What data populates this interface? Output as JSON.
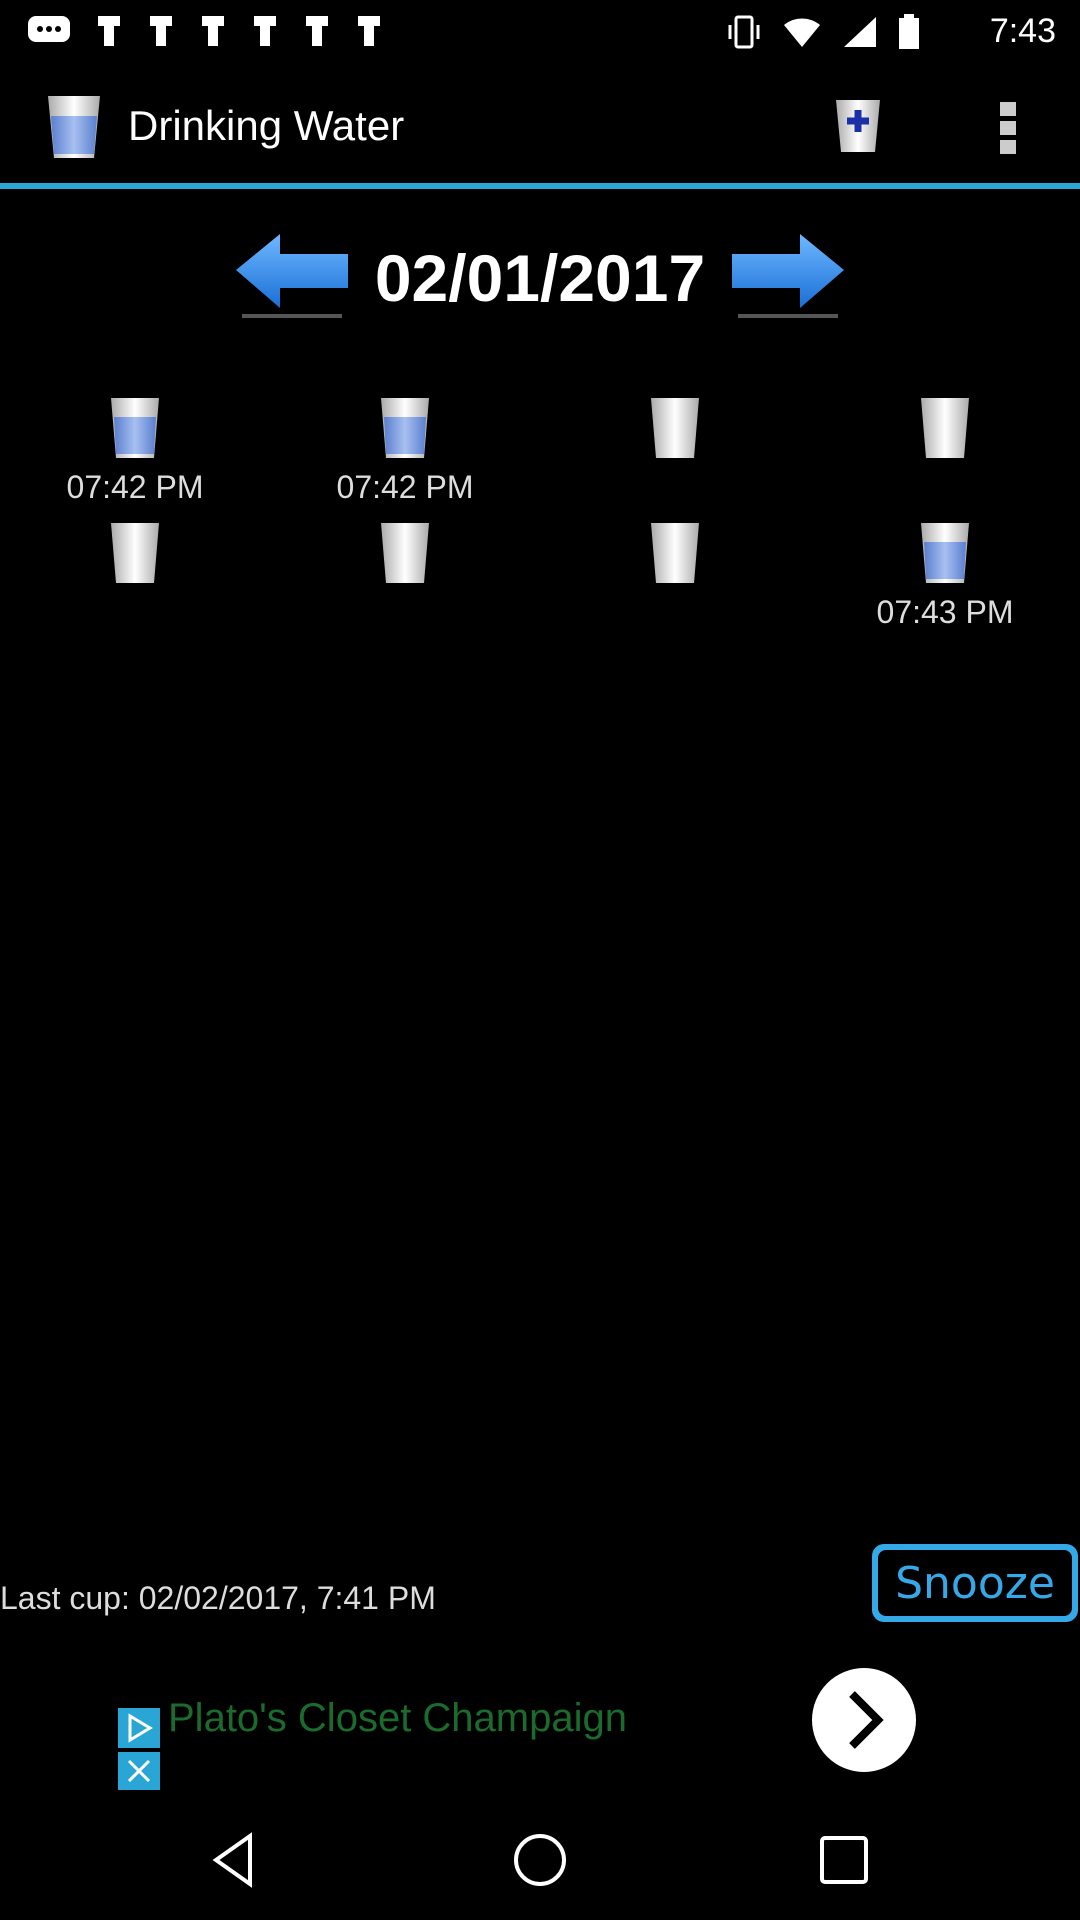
{
  "status_bar": {
    "time": "7:43",
    "left_icons": [
      "chat-bubble-icon",
      "notification-icon",
      "notification-icon",
      "notification-icon",
      "notification-icon",
      "notification-icon",
      "notification-icon"
    ],
    "right_icons": [
      "vibrate-icon",
      "wifi-icon",
      "signal-icon",
      "battery-icon"
    ]
  },
  "app_bar": {
    "title": "Drinking Water",
    "logo_icon": "water-glass-icon",
    "add_icon": "add-cup-icon",
    "menu_icon": "more-vert-icon",
    "accent_color": "#2aa6d6"
  },
  "date_nav": {
    "date": "02/01/2017",
    "prev_icon": "arrow-left-icon",
    "next_icon": "arrow-right-icon",
    "arrow_color": "#2b8fe0"
  },
  "cups": [
    {
      "filled": true,
      "time": "07:42 PM"
    },
    {
      "filled": true,
      "time": "07:42 PM"
    },
    {
      "filled": false,
      "time": ""
    },
    {
      "filled": false,
      "time": ""
    },
    {
      "filled": false,
      "time": ""
    },
    {
      "filled": false,
      "time": ""
    },
    {
      "filled": false,
      "time": ""
    },
    {
      "filled": true,
      "time": "07:43 PM"
    }
  ],
  "footer": {
    "last_cup": "Last cup: 02/02/2017,  7:41 PM",
    "snooze_label": "Snooze"
  },
  "ad": {
    "text": "Plato's Closet Champaign",
    "badge_icons": [
      "ad-choices-icon",
      "ad-close-icon"
    ],
    "cta_icon": "chevron-right-icon",
    "text_color": "#1b6b2d"
  },
  "nav_bar": {
    "icons": [
      "back-icon",
      "home-icon",
      "recents-icon"
    ]
  }
}
